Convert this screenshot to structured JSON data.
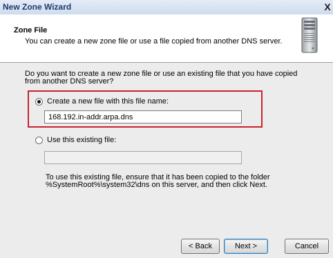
{
  "window": {
    "title": "New Zone Wizard",
    "close_glyph": "X"
  },
  "header": {
    "title": "Zone File",
    "subtitle": "You can create a new zone file or use a file copied from another DNS server.",
    "icon": "server-icon"
  },
  "body": {
    "question_line1": "Do you want to create a new zone file or use an existing file that you have copied",
    "question_line2": "from another DNS server?",
    "option_new_label": "Create a new file with this file name:",
    "option_new_value": "168.192.in-addr.arpa.dns",
    "option_existing_label": "Use this existing file:",
    "option_existing_value": "",
    "hint_line1": "To use this existing file, ensure that it has been copied to the folder",
    "hint_line2": "%SystemRoot%\\system32\\dns on this server, and then click Next."
  },
  "buttons": {
    "back": "< Back",
    "next": "Next >",
    "cancel": "Cancel"
  },
  "colors": {
    "highlight_border": "#c8232c",
    "body_bg": "#ececec"
  }
}
